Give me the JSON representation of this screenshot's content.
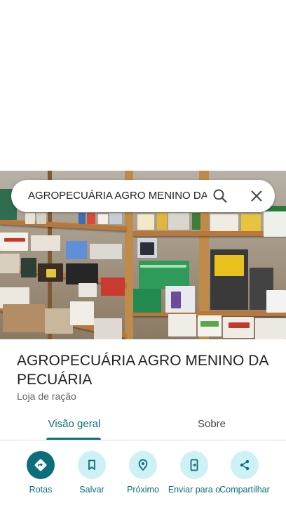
{
  "search": {
    "query": "AGROPECUÁRIA AGRO MENINO DA PECUÁRIA"
  },
  "place": {
    "title": "AGROPECUÁRIA AGRO MENINO DA PECUÁRIA",
    "category": "Loja de ração"
  },
  "tabs": [
    {
      "label": "Visão geral",
      "selected": true
    },
    {
      "label": "Sobre",
      "selected": false
    }
  ],
  "actions": [
    {
      "label": "Rotas",
      "icon": "directions-icon"
    },
    {
      "label": "Salvar",
      "icon": "bookmark-icon"
    },
    {
      "label": "Próximo",
      "icon": "nearby-icon"
    },
    {
      "label": "Enviar para o",
      "icon": "send-to-phone-icon"
    },
    {
      "label": "Compartilhar",
      "icon": "share-icon"
    }
  ],
  "colors": {
    "accent": "#0b6e7a",
    "accent_light": "#cdf1f5"
  }
}
